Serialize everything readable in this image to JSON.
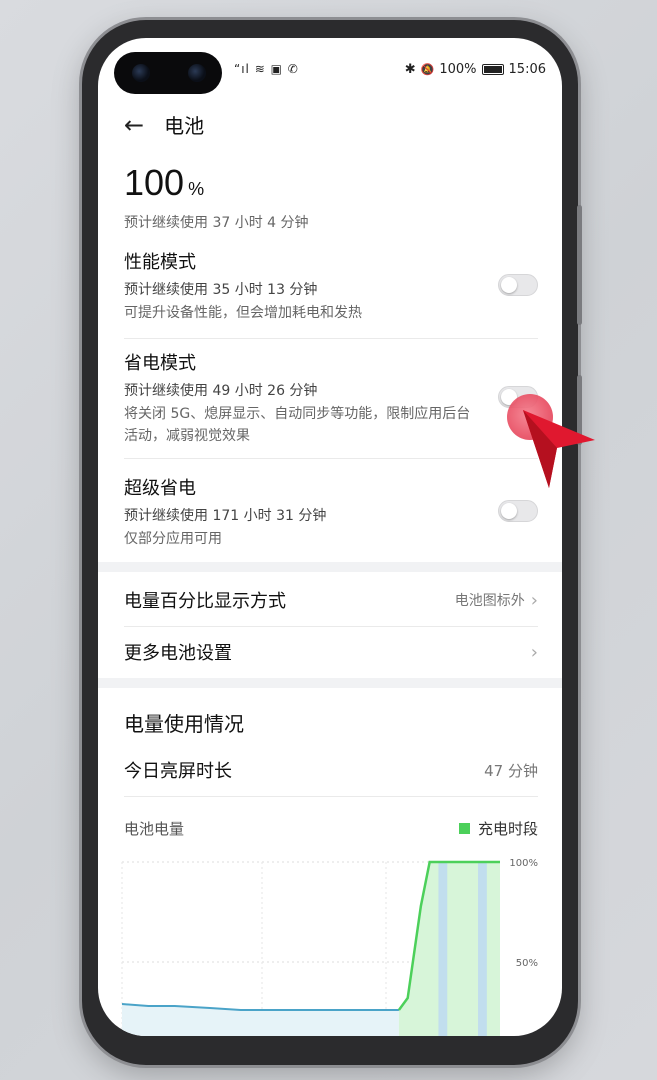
{
  "status": {
    "left": "“ıl ≋ ▣ ✆",
    "bluetooth": "✱",
    "mute": "🔕",
    "battery": "100%",
    "time": "15:06"
  },
  "header": {
    "title": "电池"
  },
  "battery": {
    "percent": "100",
    "unit": "%",
    "estimate": "预计继续使用 37 小时 4 分钟"
  },
  "modes": [
    {
      "name": "性能模式",
      "estimate": "预计继续使用 35 小时 13 分钟",
      "desc": "可提升设备性能，但会增加耗电和发热",
      "on": false
    },
    {
      "name": "省电模式",
      "estimate": "预计继续使用 49 小时 26 分钟",
      "desc": "将关闭 5G、熄屏显示、自动同步等功能，限制应用后台活动，减弱视觉效果",
      "on": false
    },
    {
      "name": "超级省电",
      "estimate": "预计继续使用 171 小时 31 分钟",
      "desc": "仅部分应用可用",
      "on": false
    }
  ],
  "settings": [
    {
      "label": "电量百分比显示方式",
      "value": "电池图标外"
    },
    {
      "label": "更多电池设置",
      "value": ""
    }
  ],
  "usage": {
    "title": "电量使用情况",
    "screen_time_label": "今日亮屏时长",
    "screen_time_value": "47 分钟"
  },
  "chart_data": {
    "type": "area",
    "title": "电池电量",
    "legend": [
      "充电时段"
    ],
    "y_ticks": [
      "100%",
      "50%"
    ],
    "ylim": [
      0,
      100
    ],
    "series": [
      {
        "name": "充电时段",
        "x": [
          0,
          6,
          12,
          20,
          27,
          63,
          65,
          68,
          70,
          78,
          86
        ],
        "y": [
          29,
          28,
          28,
          27,
          26,
          26,
          32,
          78,
          100,
          100,
          100
        ]
      }
    ],
    "colors": {
      "line_low": "#4aa3c8",
      "line_high": "#4cd05a",
      "fill_low": "#e6f3f8",
      "fill_high": "#d7f5d9",
      "charging_band": "#bcd8f2"
    }
  }
}
